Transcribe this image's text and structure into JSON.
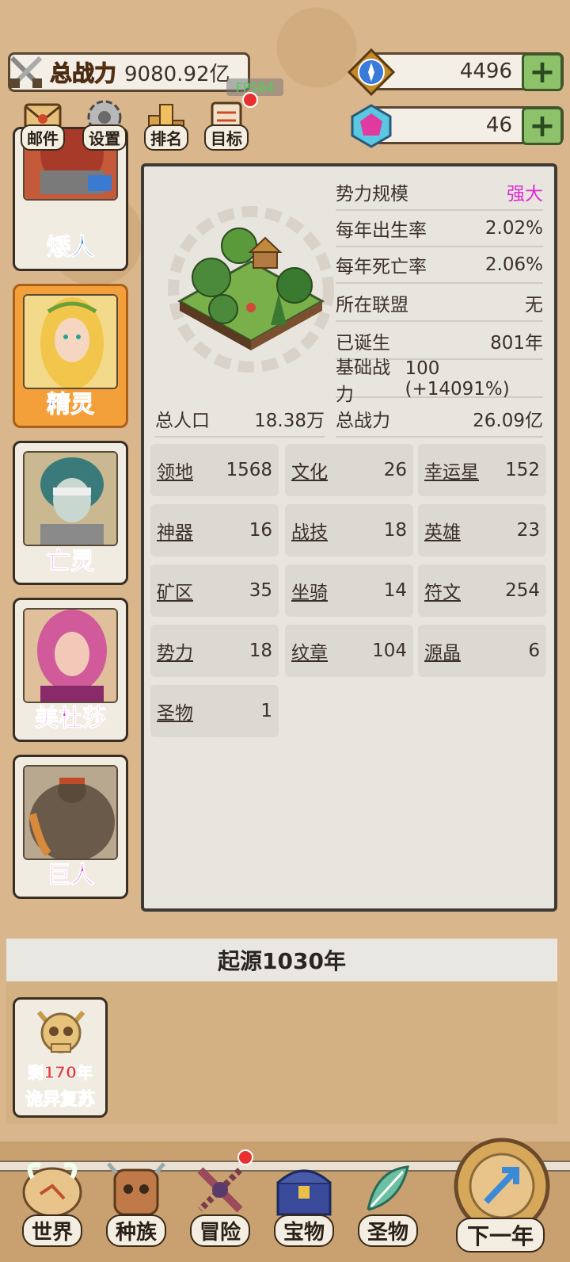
{
  "header": {
    "power_label": "总战力",
    "power_value": "9080.92亿",
    "fps": "FPS64",
    "currency_1": "4496",
    "currency_2": "46",
    "plus": "+"
  },
  "top_buttons": [
    {
      "label": "邮件"
    },
    {
      "label": "设置"
    },
    {
      "label": "排名"
    },
    {
      "label": "目标"
    }
  ],
  "races": [
    {
      "name": "矮人",
      "color": "#2a7ad0"
    },
    {
      "name": "精灵",
      "color": "#2a7ad0"
    },
    {
      "name": "亡灵",
      "color": "#e030d0"
    },
    {
      "name": "美杜莎",
      "color": "#e030d0"
    },
    {
      "name": "巨人",
      "color": "#e030d0"
    }
  ],
  "details": {
    "stats": [
      {
        "k": "势力规模",
        "v": "强大",
        "color": "#e02ad0"
      },
      {
        "k": "每年出生率",
        "v": "2.02%",
        "color": "#3a3028"
      },
      {
        "k": "每年死亡率",
        "v": "2.06%",
        "color": "#3a3028"
      },
      {
        "k": "所在联盟",
        "v": "无",
        "color": "#3a3028"
      },
      {
        "k": "已诞生",
        "v": "801年",
        "color": "#3a3028"
      },
      {
        "k": "基础战力",
        "v": "100 (+14091%)",
        "color": "#3a3028"
      },
      {
        "k": "总战力",
        "v": "26.09亿",
        "color": "#3a3028"
      }
    ],
    "population_label": "总人口",
    "population_value": "18.38万",
    "grid": [
      {
        "k": "领地",
        "v": "1568"
      },
      {
        "k": "文化",
        "v": "26"
      },
      {
        "k": "幸运星",
        "v": "152"
      },
      {
        "k": "神器",
        "v": "16"
      },
      {
        "k": "战技",
        "v": "18"
      },
      {
        "k": "英雄",
        "v": "23"
      },
      {
        "k": "矿区",
        "v": "35"
      },
      {
        "k": "坐骑",
        "v": "14"
      },
      {
        "k": "符文",
        "v": "254"
      },
      {
        "k": "势力",
        "v": "18"
      },
      {
        "k": "纹章",
        "v": "104"
      },
      {
        "k": "源晶",
        "v": "6"
      },
      {
        "k": "圣物",
        "v": "1"
      }
    ]
  },
  "era": {
    "title": "起源1030年",
    "event_line1": "剩170年",
    "event_line2": "诡异复苏"
  },
  "nav": [
    {
      "label": "世界"
    },
    {
      "label": "种族"
    },
    {
      "label": "冒险"
    },
    {
      "label": "宝物"
    },
    {
      "label": "圣物"
    }
  ],
  "next_year": "下一年"
}
